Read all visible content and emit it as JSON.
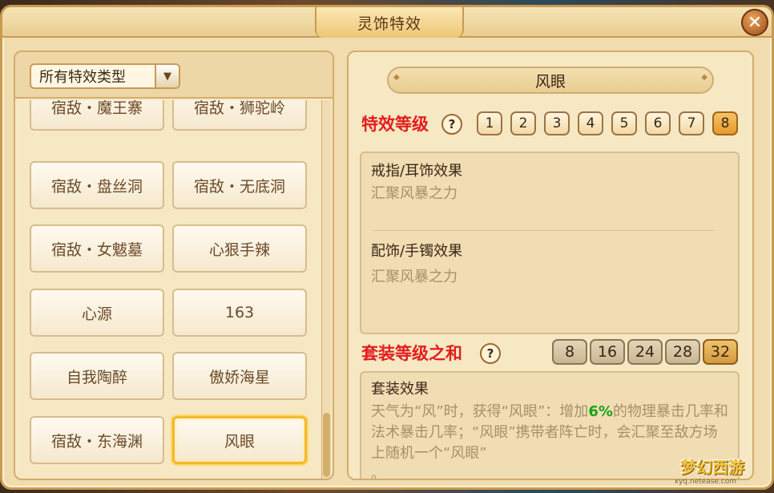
{
  "window": {
    "title": "灵饰特效",
    "close_label": "✕"
  },
  "filter": {
    "selected": "所有特效类型"
  },
  "effects": [
    "宿敌・魔王寨",
    "宿敌・狮驼岭",
    "宿敌・盘丝洞",
    "宿敌・无底洞",
    "宿敌・女魃墓",
    "心狠手辣",
    "心源",
    "163",
    "自我陶醉",
    "傲娇海星",
    "宿敌・东海渊",
    "风眼"
  ],
  "selected_effect": "风眼",
  "detail": {
    "name": "风眼",
    "level_title": "特效等级",
    "levels": [
      "1",
      "2",
      "3",
      "4",
      "5",
      "6",
      "7",
      "8"
    ],
    "active_level": "8",
    "ring_heading": "戒指/耳饰效果",
    "ring_text": "汇聚风暴之力",
    "acc_heading": "配饰/手镯效果",
    "acc_text": "汇聚风暴之力",
    "set_title": "套装等级之和",
    "set_levels": [
      "8",
      "16",
      "24",
      "28",
      "32"
    ],
    "active_set_level": "32",
    "set_heading": "套装效果",
    "set_desc_before": "天气为“风”时，获得“风眼”：增加",
    "set_desc_pct": "6%",
    "set_desc_after": "的物理暴击几率和法术暴击几率；“风眼”携带者阵亡时，会汇聚至敌方场上随机一个“风眼”",
    "set_desc_tail": "。"
  },
  "watermark": {
    "text": "梦幻西游",
    "sub": "xyq.netease.com"
  },
  "colors": {
    "title_red": "#e21d1d",
    "percent_green": "#18a418",
    "selected_border": "#f4b82a"
  }
}
